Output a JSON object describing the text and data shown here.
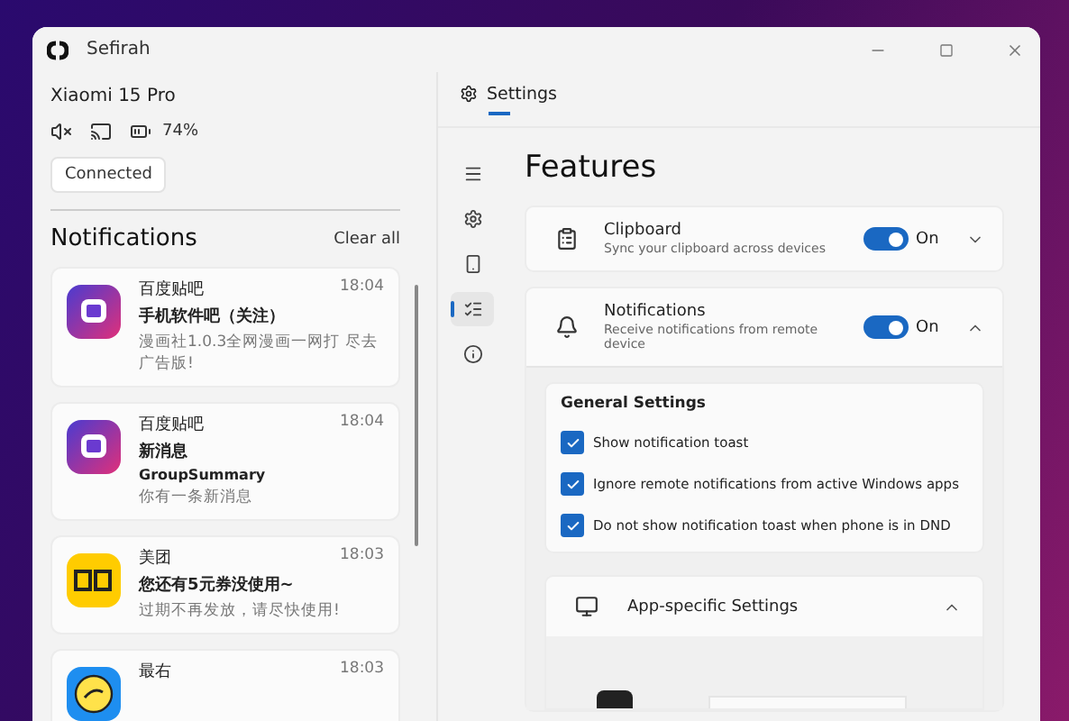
{
  "window": {
    "title": "Sefirah"
  },
  "device": {
    "name": "Xiaomi 15 Pro",
    "muted": true,
    "battery": "74%",
    "status": "Connected"
  },
  "notifications": {
    "title": "Notifications",
    "clear": "Clear all",
    "items": [
      {
        "app": "百度贴吧",
        "time": "18:04",
        "title": "手机软件吧（关注）",
        "body": "漫画社1.0.3全网漫画一网打 尽去广告版!"
      },
      {
        "app": "百度贴吧",
        "time": "18:04",
        "title": "新消息",
        "lines": [
          "GroupSummary"
        ],
        "body": "你有一条新消息"
      },
      {
        "app": "美团",
        "time": "18:03",
        "title": "您还有5元券没使用~",
        "body": "过期不再发放，请尽快使用!"
      },
      {
        "app": "最右",
        "time": "18:03"
      }
    ]
  },
  "tabs": [
    {
      "label": "Settings",
      "selected": true
    }
  ],
  "nav": [
    {
      "selected": false
    },
    {
      "selected": false
    },
    {
      "selected": false
    },
    {
      "selected": true
    },
    {
      "selected": false
    }
  ],
  "page": {
    "title": "Features",
    "features": [
      {
        "name": "Clipboard",
        "description": "Sync your clipboard across devices",
        "on": true,
        "state": "On",
        "expanded": false
      },
      {
        "name": "Notifications",
        "description": "Receive notifications from remote device",
        "on": true,
        "state": "On",
        "expanded": true
      }
    ],
    "general": {
      "title": "General Settings",
      "options": [
        {
          "label": "Show notification toast",
          "checked": true
        },
        {
          "label": "Ignore remote notifications from active Windows apps",
          "checked": true
        },
        {
          "label": "Do not show notification toast when phone is in DND",
          "checked": true
        }
      ]
    },
    "app_specific": {
      "title": "App-specific Settings",
      "expanded": true
    }
  }
}
